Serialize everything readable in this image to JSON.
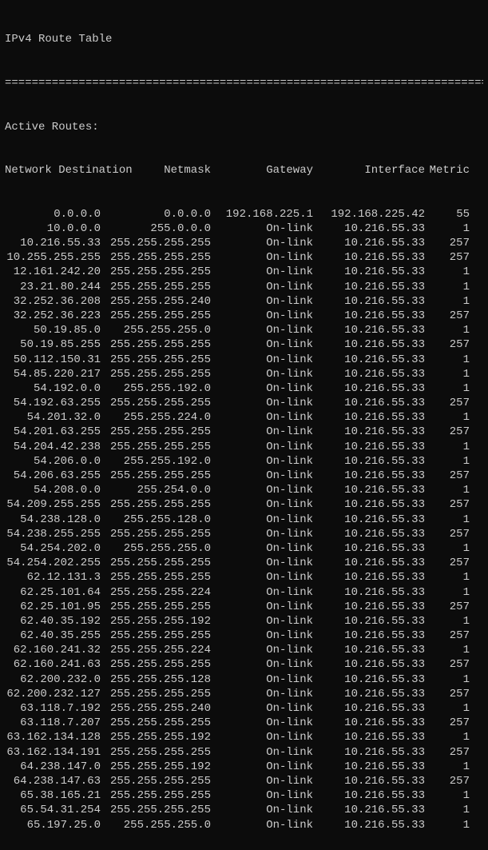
{
  "title": "IPv4 Route Table",
  "rule": "===========================================================================",
  "section": "Active Routes:",
  "headers": {
    "dest": "Network Destination",
    "mask": "Netmask",
    "gw": "Gateway",
    "iface": "Interface",
    "metric": "Metric"
  },
  "routes": [
    {
      "dest": "0.0.0.0",
      "mask": "0.0.0.0",
      "gw": "192.168.225.1",
      "iface": "192.168.225.42",
      "metric": "55"
    },
    {
      "dest": "10.0.0.0",
      "mask": "255.0.0.0",
      "gw": "On-link",
      "iface": "10.216.55.33",
      "metric": "1"
    },
    {
      "dest": "10.216.55.33",
      "mask": "255.255.255.255",
      "gw": "On-link",
      "iface": "10.216.55.33",
      "metric": "257"
    },
    {
      "dest": "10.255.255.255",
      "mask": "255.255.255.255",
      "gw": "On-link",
      "iface": "10.216.55.33",
      "metric": "257"
    },
    {
      "dest": "12.161.242.20",
      "mask": "255.255.255.255",
      "gw": "On-link",
      "iface": "10.216.55.33",
      "metric": "1"
    },
    {
      "dest": "23.21.80.244",
      "mask": "255.255.255.255",
      "gw": "On-link",
      "iface": "10.216.55.33",
      "metric": "1"
    },
    {
      "dest": "32.252.36.208",
      "mask": "255.255.255.240",
      "gw": "On-link",
      "iface": "10.216.55.33",
      "metric": "1"
    },
    {
      "dest": "32.252.36.223",
      "mask": "255.255.255.255",
      "gw": "On-link",
      "iface": "10.216.55.33",
      "metric": "257"
    },
    {
      "dest": "50.19.85.0",
      "mask": "255.255.255.0",
      "gw": "On-link",
      "iface": "10.216.55.33",
      "metric": "1"
    },
    {
      "dest": "50.19.85.255",
      "mask": "255.255.255.255",
      "gw": "On-link",
      "iface": "10.216.55.33",
      "metric": "257"
    },
    {
      "dest": "50.112.150.31",
      "mask": "255.255.255.255",
      "gw": "On-link",
      "iface": "10.216.55.33",
      "metric": "1"
    },
    {
      "dest": "54.85.220.217",
      "mask": "255.255.255.255",
      "gw": "On-link",
      "iface": "10.216.55.33",
      "metric": "1"
    },
    {
      "dest": "54.192.0.0",
      "mask": "255.255.192.0",
      "gw": "On-link",
      "iface": "10.216.55.33",
      "metric": "1"
    },
    {
      "dest": "54.192.63.255",
      "mask": "255.255.255.255",
      "gw": "On-link",
      "iface": "10.216.55.33",
      "metric": "257"
    },
    {
      "dest": "54.201.32.0",
      "mask": "255.255.224.0",
      "gw": "On-link",
      "iface": "10.216.55.33",
      "metric": "1"
    },
    {
      "dest": "54.201.63.255",
      "mask": "255.255.255.255",
      "gw": "On-link",
      "iface": "10.216.55.33",
      "metric": "257"
    },
    {
      "dest": "54.204.42.238",
      "mask": "255.255.255.255",
      "gw": "On-link",
      "iface": "10.216.55.33",
      "metric": "1"
    },
    {
      "dest": "54.206.0.0",
      "mask": "255.255.192.0",
      "gw": "On-link",
      "iface": "10.216.55.33",
      "metric": "1"
    },
    {
      "dest": "54.206.63.255",
      "mask": "255.255.255.255",
      "gw": "On-link",
      "iface": "10.216.55.33",
      "metric": "257"
    },
    {
      "dest": "54.208.0.0",
      "mask": "255.254.0.0",
      "gw": "On-link",
      "iface": "10.216.55.33",
      "metric": "1"
    },
    {
      "dest": "54.209.255.255",
      "mask": "255.255.255.255",
      "gw": "On-link",
      "iface": "10.216.55.33",
      "metric": "257"
    },
    {
      "dest": "54.238.128.0",
      "mask": "255.255.128.0",
      "gw": "On-link",
      "iface": "10.216.55.33",
      "metric": "1"
    },
    {
      "dest": "54.238.255.255",
      "mask": "255.255.255.255",
      "gw": "On-link",
      "iface": "10.216.55.33",
      "metric": "257"
    },
    {
      "dest": "54.254.202.0",
      "mask": "255.255.255.0",
      "gw": "On-link",
      "iface": "10.216.55.33",
      "metric": "1"
    },
    {
      "dest": "54.254.202.255",
      "mask": "255.255.255.255",
      "gw": "On-link",
      "iface": "10.216.55.33",
      "metric": "257"
    },
    {
      "dest": "62.12.131.3",
      "mask": "255.255.255.255",
      "gw": "On-link",
      "iface": "10.216.55.33",
      "metric": "1"
    },
    {
      "dest": "62.25.101.64",
      "mask": "255.255.255.224",
      "gw": "On-link",
      "iface": "10.216.55.33",
      "metric": "1"
    },
    {
      "dest": "62.25.101.95",
      "mask": "255.255.255.255",
      "gw": "On-link",
      "iface": "10.216.55.33",
      "metric": "257"
    },
    {
      "dest": "62.40.35.192",
      "mask": "255.255.255.192",
      "gw": "On-link",
      "iface": "10.216.55.33",
      "metric": "1"
    },
    {
      "dest": "62.40.35.255",
      "mask": "255.255.255.255",
      "gw": "On-link",
      "iface": "10.216.55.33",
      "metric": "257"
    },
    {
      "dest": "62.160.241.32",
      "mask": "255.255.255.224",
      "gw": "On-link",
      "iface": "10.216.55.33",
      "metric": "1"
    },
    {
      "dest": "62.160.241.63",
      "mask": "255.255.255.255",
      "gw": "On-link",
      "iface": "10.216.55.33",
      "metric": "257"
    },
    {
      "dest": "62.200.232.0",
      "mask": "255.255.255.128",
      "gw": "On-link",
      "iface": "10.216.55.33",
      "metric": "1"
    },
    {
      "dest": "62.200.232.127",
      "mask": "255.255.255.255",
      "gw": "On-link",
      "iface": "10.216.55.33",
      "metric": "257"
    },
    {
      "dest": "63.118.7.192",
      "mask": "255.255.255.240",
      "gw": "On-link",
      "iface": "10.216.55.33",
      "metric": "1"
    },
    {
      "dest": "63.118.7.207",
      "mask": "255.255.255.255",
      "gw": "On-link",
      "iface": "10.216.55.33",
      "metric": "257"
    },
    {
      "dest": "63.162.134.128",
      "mask": "255.255.255.192",
      "gw": "On-link",
      "iface": "10.216.55.33",
      "metric": "1"
    },
    {
      "dest": "63.162.134.191",
      "mask": "255.255.255.255",
      "gw": "On-link",
      "iface": "10.216.55.33",
      "metric": "257"
    },
    {
      "dest": "64.238.147.0",
      "mask": "255.255.255.192",
      "gw": "On-link",
      "iface": "10.216.55.33",
      "metric": "1"
    },
    {
      "dest": "64.238.147.63",
      "mask": "255.255.255.255",
      "gw": "On-link",
      "iface": "10.216.55.33",
      "metric": "257"
    },
    {
      "dest": "65.38.165.21",
      "mask": "255.255.255.255",
      "gw": "On-link",
      "iface": "10.216.55.33",
      "metric": "1"
    },
    {
      "dest": "65.54.31.254",
      "mask": "255.255.255.255",
      "gw": "On-link",
      "iface": "10.216.55.33",
      "metric": "1"
    },
    {
      "dest": "65.197.25.0",
      "mask": "255.255.255.0",
      "gw": "On-link",
      "iface": "10.216.55.33",
      "metric": "1"
    }
  ]
}
